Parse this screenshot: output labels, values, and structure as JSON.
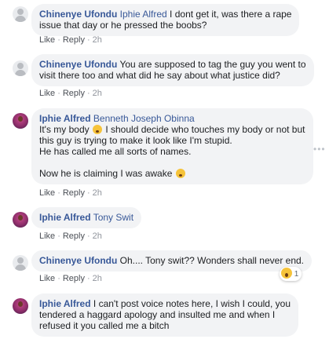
{
  "comments": [
    {
      "author": "Chinenye Ufondu",
      "tag": "Iphie Alfred",
      "lines": [
        " I dont get it, was there a rape",
        "issue that day or he pressed the boobs?"
      ],
      "like": "Like",
      "reply": "Reply",
      "time": "2h"
    },
    {
      "author": "Chinenye Ufondu",
      "lines": [
        " You are supposed to tag the guy you went to",
        "visit there too and what did he say about what justice did?"
      ],
      "like": "Like",
      "reply": "Reply",
      "time": "2h"
    },
    {
      "author": "Iphie Alfred",
      "tag": "Benneth Joseph Obinna",
      "lines": [
        "It's my body",
        " I should decide who touches my body or not but",
        "this guy is trying to make it look like I'm stupid.",
        "He has called me all sorts of names.",
        "Now he is claiming I was awake"
      ],
      "like": "Like",
      "reply": "Reply",
      "time": "2h"
    },
    {
      "author": "Iphie Alfred",
      "tag": "Tony Swit",
      "like": "Like",
      "reply": "Reply",
      "time": "2h"
    },
    {
      "author": "Chinenye Ufondu",
      "lines": [
        " Oh.... Tony swit?? Wonders shall never end."
      ],
      "like": "Like",
      "reply": "Reply",
      "time": "2h",
      "reaction_count": "1"
    },
    {
      "author": "Iphie Alfred",
      "lines": [
        " I can't post voice notes here, I wish I could, you",
        "tendered a haggard apology and insulted me and when I",
        "refused it you called me a bitch"
      ]
    }
  ],
  "more_options": "•••",
  "dot": "·",
  "emoji_icon": "astonished-face-icon",
  "reaction_icon": "wow-reaction-icon",
  "colors": {
    "link": "#385898",
    "bubble": "#f2f3f5",
    "meta": "#90949c"
  }
}
